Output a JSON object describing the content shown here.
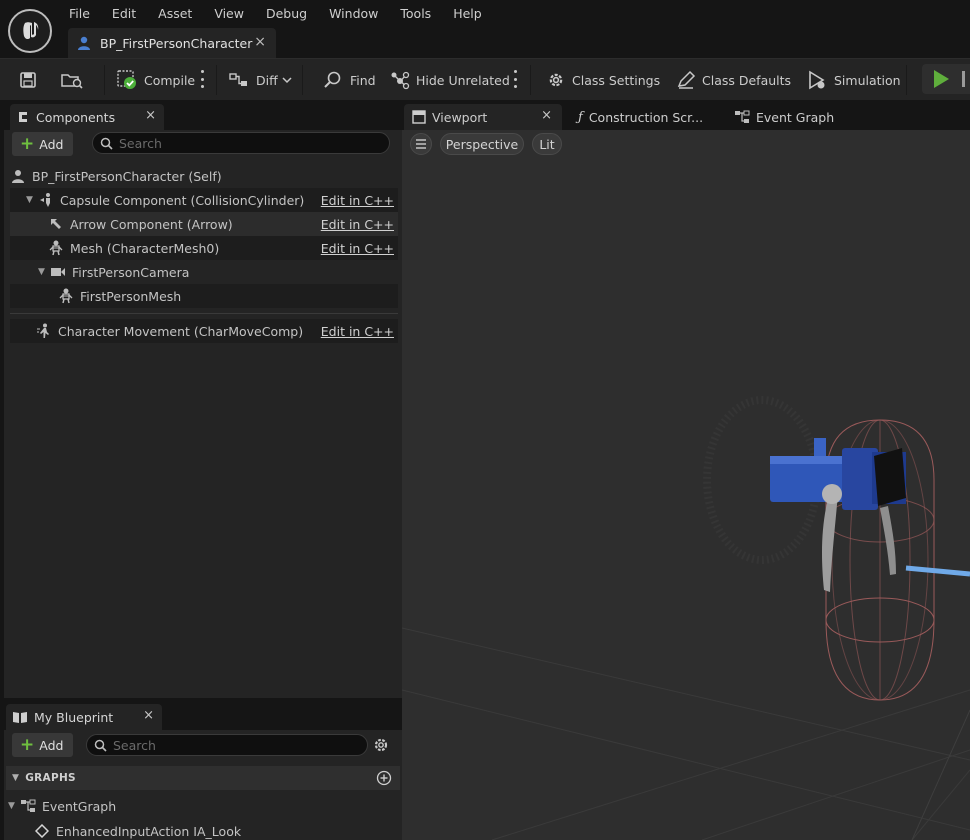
{
  "menu": [
    "File",
    "Edit",
    "Asset",
    "View",
    "Debug",
    "Window",
    "Tools",
    "Help"
  ],
  "asset_tab": {
    "label": "BP_FirstPersonCharacter",
    "close": "×"
  },
  "toolbar": {
    "compile": "Compile",
    "diff": "Diff",
    "find": "Find",
    "hide_unrelated": "Hide Unrelated",
    "class_settings": "Class Settings",
    "class_defaults": "Class Defaults",
    "simulation": "Simulation"
  },
  "components_panel": {
    "title": "Components",
    "close": "×",
    "add_label": "Add",
    "search_placeholder": "Search",
    "root": "BP_FirstPersonCharacter (Self)",
    "items": [
      {
        "label": "Capsule Component (CollisionCylinder)",
        "icon": "capsule-icon",
        "edit": "Edit in C++"
      },
      {
        "label": "Arrow Component (Arrow)",
        "icon": "arrow-component-icon",
        "edit": "Edit in C++"
      },
      {
        "label": "Mesh (CharacterMesh0)",
        "icon": "skeletal-mesh-icon",
        "edit": "Edit in C++"
      },
      {
        "label": "FirstPersonCamera",
        "icon": "camera-icon"
      },
      {
        "label": "FirstPersonMesh",
        "icon": "skeletal-mesh-icon"
      },
      {
        "label": "Character Movement (CharMoveComp)",
        "icon": "movement-icon",
        "edit": "Edit in C++"
      }
    ]
  },
  "my_blueprint": {
    "title": "My Blueprint",
    "close": "×",
    "add_label": "Add",
    "search_placeholder": "Search",
    "section_graphs": "GRAPHS",
    "event_graph": "EventGraph",
    "event_item": "EnhancedInputAction IA_Look"
  },
  "editor_tabs": {
    "viewport": "Viewport",
    "construction": "Construction Scr...",
    "event_graph": "Event Graph",
    "close": "×"
  },
  "viewport": {
    "perspective": "Perspective",
    "lit": "Lit"
  },
  "colors": {
    "accent_green": "#6fbf3f",
    "panel": "#242424",
    "background": "#151515",
    "viewport": "#2e2e2e",
    "capsule_wire": "#b06a6a",
    "camera_blue": "#2f57b8"
  }
}
